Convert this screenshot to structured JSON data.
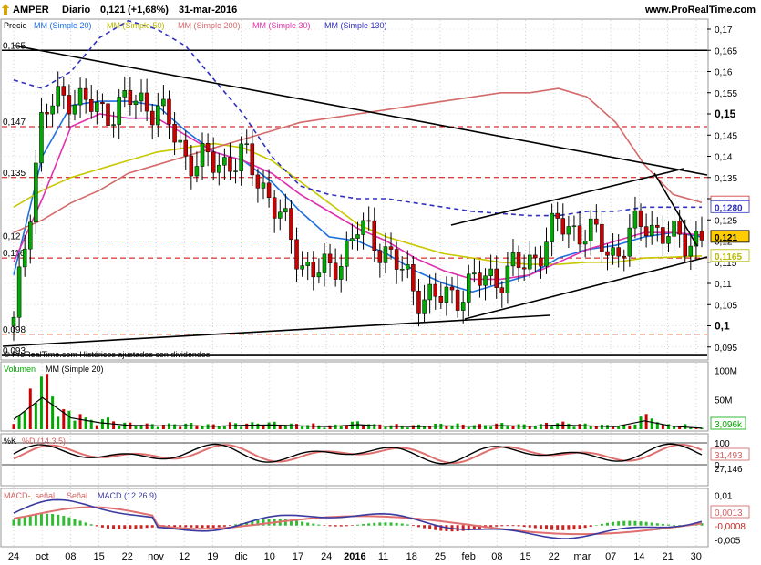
{
  "header": {
    "symbol": "AMPER",
    "period": "Diario",
    "price": "0,121",
    "change": "(+1,68%)",
    "date": "31-mar-2016",
    "site": "www.ProRealTime.com"
  },
  "colors": {
    "up": "#00aa00",
    "down": "#cc0000",
    "mm20": "#1e6fe0",
    "mm50": "#c8c800",
    "mm200": "#d46a6a",
    "mm30": "#e030b0",
    "mm130": "#3030c0",
    "stoch_k": "#000000",
    "stoch_d": "#e07070",
    "macd": "#3a3aa0",
    "signal": "#e07070",
    "hist_pos": "#33bb33",
    "hist_neg": "#cc2222"
  },
  "price_panel": {
    "legend": [
      "Precio",
      "MM (Simple 20)",
      "MM (Simple 50)",
      "MM (Simple 200)",
      "MM (Simple 30)",
      "MM (Simple 130)"
    ],
    "footer": "© ProRealTime.com Históricos ajustados con dividendos",
    "left_labels": [
      "0,165",
      "0,147",
      "0,135",
      "0,12",
      "0,116",
      "0,098",
      "0,093"
    ],
    "value_labels": [
      "0,1291",
      "0,1280",
      "0,121",
      "0,1165"
    ],
    "yticks": [
      "0,17",
      "0,165",
      "0,16",
      "0,155",
      "0,15",
      "0,145",
      "0,14",
      "0,135",
      "0,13",
      "0,125",
      "0,12",
      "0,115",
      "0,11",
      "0,105",
      "0,1",
      "0,095",
      "0,09"
    ]
  },
  "volume_panel": {
    "legend": [
      "Volumen",
      "MM (Simple 20)"
    ],
    "yticks": [
      "100M",
      "50M"
    ],
    "value_label": "3,096k"
  },
  "stoch_panel": {
    "legend": [
      "%K",
      "%D (14 3 5)"
    ],
    "yticks": [
      "100",
      "0"
    ],
    "value_labels": [
      "31,493",
      "27,146"
    ]
  },
  "macd_panel": {
    "legend": [
      "MACD-, señal",
      "Señal",
      "MACD (12 26 9)"
    ],
    "yticks": [
      "0,01",
      "0,005",
      "-0,005"
    ],
    "value_labels": [
      "0,0013",
      "-0,0008"
    ]
  },
  "xaxis": {
    "labels": [
      "24",
      "oct",
      "08",
      "15",
      "22",
      "nov",
      "12",
      "19",
      "dic",
      "10",
      "17",
      "24",
      "2016",
      "11",
      "18",
      "25",
      "feb",
      "08",
      "15",
      "22",
      "mar",
      "07",
      "14",
      "21",
      "30"
    ]
  },
  "chart_data": {
    "type": "line",
    "title": "AMPER Diario",
    "price_range": [
      0.09,
      0.17
    ],
    "x": [
      "24-sep-2015",
      "oct-2015",
      "08-oct",
      "15-oct",
      "22-oct",
      "nov-2015",
      "12-nov",
      "19-nov",
      "dic-2015",
      "10-dic",
      "17-dic",
      "24-dic",
      "2016",
      "11-ene",
      "18-ene",
      "25-ene",
      "feb-2016",
      "08-feb",
      "15-feb",
      "22-feb",
      "mar-2016",
      "07-mar",
      "14-mar",
      "21-mar",
      "30-mar"
    ],
    "series": [
      {
        "name": "Precio",
        "values": [
          0.1,
          0.15,
          0.155,
          0.15,
          0.153,
          0.152,
          0.14,
          0.138,
          0.14,
          0.13,
          0.115,
          0.112,
          0.123,
          0.118,
          0.108,
          0.106,
          0.11,
          0.112,
          0.115,
          0.124,
          0.122,
          0.117,
          0.125,
          0.12,
          0.121
        ]
      },
      {
        "name": "MM (Simple 20)",
        "values": [
          0.112,
          0.14,
          0.152,
          0.153,
          0.153,
          0.152,
          0.146,
          0.141,
          0.139,
          0.134,
          0.127,
          0.121,
          0.12,
          0.117,
          0.113,
          0.11,
          0.108,
          0.11,
          0.112,
          0.116,
          0.118,
          0.119,
          0.121,
          0.122,
          0.121
        ]
      },
      {
        "name": "MM (Simple 50)",
        "values": [
          0.128,
          0.132,
          0.135,
          0.137,
          0.139,
          0.141,
          0.142,
          0.143,
          0.142,
          0.139,
          0.134,
          0.129,
          0.124,
          0.121,
          0.119,
          0.117,
          0.116,
          0.115,
          0.1145,
          0.1145,
          0.115,
          0.115,
          0.116,
          0.1162,
          0.1165
        ]
      },
      {
        "name": "MM (Simple 200)",
        "values": [
          0.122,
          0.125,
          0.129,
          0.132,
          0.136,
          0.138,
          0.14,
          0.142,
          0.144,
          0.146,
          0.148,
          0.149,
          0.15,
          0.151,
          0.152,
          0.153,
          0.154,
          0.155,
          0.155,
          0.156,
          0.154,
          0.148,
          0.138,
          0.131,
          0.1291
        ]
      },
      {
        "name": "MM (Simple 30)",
        "values": [
          0.115,
          0.13,
          0.147,
          0.15,
          0.149,
          0.149,
          0.145,
          0.141,
          0.139,
          0.136,
          0.131,
          0.127,
          0.123,
          0.12,
          0.116,
          0.113,
          0.111,
          0.111,
          0.112,
          0.115,
          0.118,
          0.12,
          0.122,
          0.122,
          0.1214
        ]
      },
      {
        "name": "MM (Simple 130)",
        "values": [
          0.158,
          0.156,
          0.16,
          0.168,
          0.172,
          0.17,
          0.166,
          0.158,
          0.15,
          0.14,
          0.133,
          0.131,
          0.13,
          0.13,
          0.129,
          0.128,
          0.127,
          0.1265,
          0.126,
          0.126,
          0.127,
          0.127,
          0.128,
          0.128,
          0.128
        ]
      }
    ],
    "horizontal_levels": [
      0.165,
      0.147,
      0.135,
      0.12,
      0.116,
      0.098,
      0.093
    ],
    "volume": [
      30,
      98,
      35,
      20,
      12,
      10,
      11,
      9,
      12,
      13,
      10,
      8,
      14,
      9,
      8,
      10,
      9,
      11,
      9,
      13,
      10,
      8,
      26,
      9,
      3.1
    ],
    "stochastic": {
      "k_last": 27.146,
      "d_last": 31.493
    },
    "macd": {
      "macd_last": 0.0013,
      "signal_last": -0.0008,
      "ylim": [
        -0.006,
        0.011
      ]
    }
  }
}
